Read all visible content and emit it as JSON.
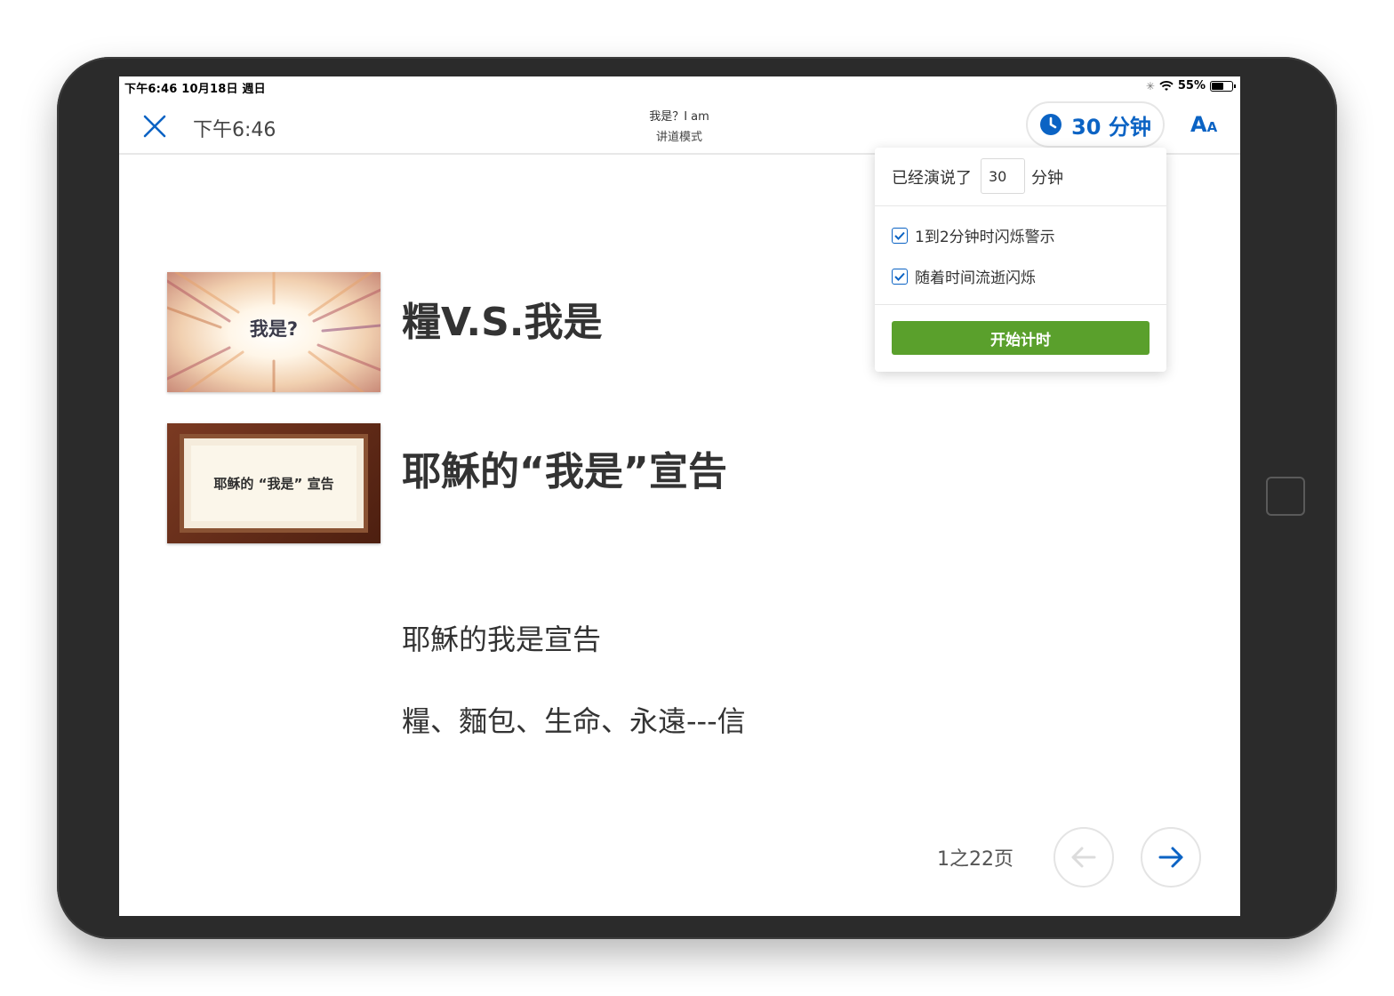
{
  "status_bar": {
    "time_date": "下午6:46  10月18日 週日",
    "battery": "55%",
    "battery_level": 0.55
  },
  "header": {
    "clock": "下午6:46",
    "title": "我是？I am",
    "subtitle": "讲道模式",
    "timer_label": "30 分钟",
    "font_button_big": "A",
    "font_button_small": "A"
  },
  "timer_popover": {
    "prefix": "已经演说了",
    "minutes_value": "30",
    "unit": "分钟",
    "options": [
      {
        "label": "1到2分钟时闪烁警示",
        "checked": true
      },
      {
        "label": "随着时间流逝闪烁",
        "checked": true
      }
    ],
    "start_label": "开始计时"
  },
  "slides": [
    {
      "thumb_text": "我是?",
      "title": "糧V.S.我是"
    },
    {
      "thumb_text": "耶稣的 “我是” 宣告",
      "title": "耶穌的“我是”宣告"
    }
  ],
  "notes": [
    "耶穌的我是宣告",
    "糧、麵包、生命、永遠---信"
  ],
  "pager": {
    "text": "1之22页",
    "current": 1,
    "total": 22
  },
  "colors": {
    "accent": "#0b63c4",
    "start_button": "#5aa02c",
    "device_frame": "#2b2b2b"
  }
}
